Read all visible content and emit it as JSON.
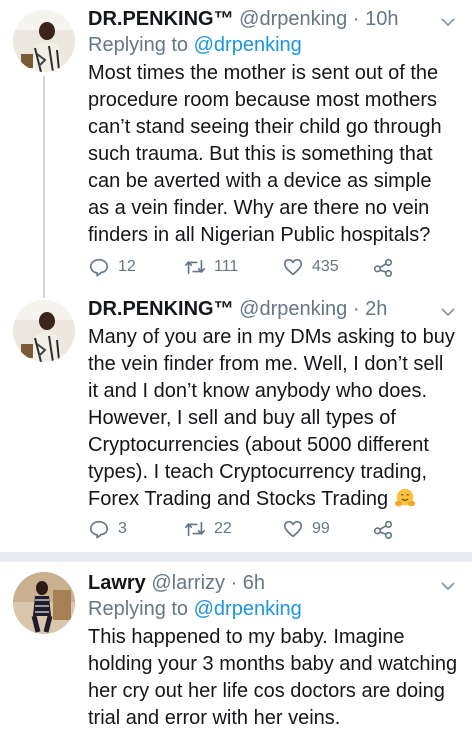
{
  "tweets": [
    {
      "name": "DR.PENKING™",
      "handle": "@drpenking",
      "time": "· 10h",
      "replying_prefix": "Replying to",
      "replying_handle": "@drpenking",
      "text": "Most times the mother is sent out of the procedure room because most mothers can’t stand seeing their child go through such trauma. But this is something that can be averted with a device as simple as a vein finder. Why are there no vein finders in all Nigerian Public hospitals?",
      "replies": "12",
      "retweets": "111",
      "likes": "435"
    },
    {
      "name": "DR.PENKING™",
      "handle": "@drpenking",
      "time": "· 2h",
      "text": "Many of you are in my DMs asking to buy the vein finder from me. Well, I don’t sell it and I don’t know anybody who does. However, I sell and buy all types of Cryptocurrencies (about 5000 different types). I teach Cryptocurrency trading, Forex Trading and Stocks Trading",
      "replies": "3",
      "retweets": "22",
      "likes": "99"
    },
    {
      "name": "Lawry",
      "handle": "@larrizy",
      "time": "· 6h",
      "replying_prefix": "Replying to",
      "replying_handle": "@drpenking",
      "text": "This happened to my baby. Imagine holding your 3 months baby and watching her cry out her life cos doctors are doing trial and error with her veins."
    }
  ],
  "colors": {
    "text": "#14171a",
    "muted": "#657786",
    "link": "#1b95e0",
    "separator": "#e6ecf0"
  },
  "icons": [
    "reply-icon",
    "retweet-icon",
    "like-icon",
    "share-icon",
    "caret-down-icon",
    "hugging-face-emoji"
  ]
}
